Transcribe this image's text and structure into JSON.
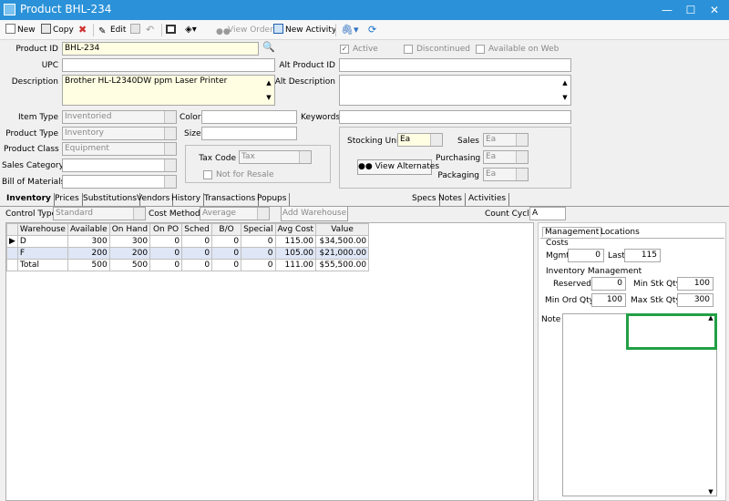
{
  "window": {
    "title": "Product BHL-234",
    "minimize": "—",
    "maximize": "☐",
    "close": "✕"
  },
  "toolbar": {
    "new": "New",
    "copy": "Copy",
    "edit": "Edit",
    "view_order": "View Order",
    "new_activity": "New Activity"
  },
  "product": {
    "labels": {
      "product_id": "Product ID",
      "upc": "UPC",
      "description": "Description",
      "alt_product_id": "Alt Product ID",
      "alt_description": "Alt Description",
      "item_type": "Item Type",
      "product_type": "Product Type",
      "product_class": "Product Class",
      "sales_category": "Sales Category",
      "bill_of_materials": "Bill of Materials",
      "color": "Color",
      "size": "Size",
      "keywords": "Keywords",
      "tax_code": "Tax Code",
      "not_for_resale": "Not for Resale",
      "active": "Active",
      "discontinued": "Discontinued",
      "available_on_web": "Available on Web"
    },
    "product_id": "BHL-234",
    "upc": "",
    "description": "Brother HL-L2340DW ppm Laser Printer",
    "alt_product_id": "",
    "alt_description": "",
    "item_type": "Inventoried",
    "product_type": "Inventory",
    "product_class": "Equipment",
    "sales_category": "",
    "bill_of_materials": "",
    "color": "",
    "size": "",
    "keywords": "",
    "tax_code": "Tax",
    "active_checked": "✓"
  },
  "units": {
    "stocking_unit_label": "Stocking Unit",
    "stocking_unit": "Ea",
    "sales_label": "Sales",
    "sales": "Ea",
    "purchasing_label": "Purchasing",
    "purchasing": "Ea",
    "packaging_label": "Packaging",
    "packaging": "Ea",
    "view_alternates": "View Alternates"
  },
  "tabs": {
    "left": [
      "Inventory",
      "Prices",
      "Substitutions",
      "Vendors",
      "History",
      "Transactions",
      "Popups"
    ],
    "right": [
      "Specs",
      "Notes",
      "Activities"
    ]
  },
  "inventory": {
    "control_type_label": "Control Type",
    "control_type": "Standard",
    "cost_method_label": "Cost Method",
    "cost_method": "Average",
    "add_warehouse": "Add Warehouse",
    "count_cycle_label": "Count Cycle",
    "count_cycle": "A",
    "columns": [
      "Warehouse",
      "Available",
      "On Hand",
      "On PO",
      "Sched",
      "B/O",
      "Special",
      "Avg Cost",
      "Value"
    ],
    "rows": [
      [
        "D",
        "300",
        "300",
        "0",
        "0",
        "0",
        "0",
        "115.00",
        "$34,500.00"
      ],
      [
        "F",
        "200",
        "200",
        "0",
        "0",
        "0",
        "0",
        "105.00",
        "$21,000.00"
      ],
      [
        "Total",
        "500",
        "500",
        "0",
        "0",
        "0",
        "0",
        "111.00",
        "$55,500.00"
      ]
    ]
  },
  "management": {
    "tabs": [
      "Management",
      "Locations"
    ],
    "costs_label": "Costs",
    "mgmt_label": "Mgmt",
    "mgmt": "0",
    "last_label": "Last",
    "last": "115",
    "inv_mgmt_label": "Inventory Management",
    "reserved_label": "Reserved",
    "reserved": "0",
    "min_stk_label": "Min Stk Qty",
    "min_stk": "100",
    "min_ord_label": "Min Ord Qty",
    "min_ord": "100",
    "max_stk_label": "Max Stk Qty",
    "max_stk": "300",
    "note_label": "Note",
    "note": ""
  },
  "colors": {
    "titlebar": "#2b92d9",
    "highlight": "#22a045",
    "required": "#fffde2"
  }
}
